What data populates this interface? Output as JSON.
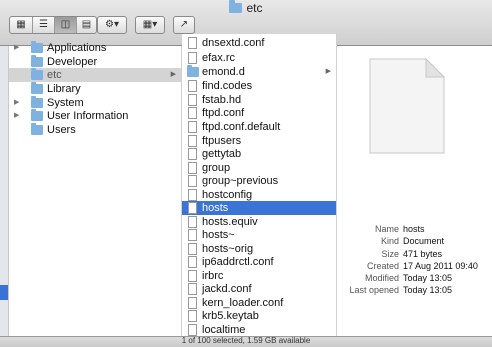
{
  "window": {
    "title": "etc"
  },
  "toolbar": {
    "view_icons": [
      "icon-view-icon",
      "list-view-icon",
      "column-view-icon",
      "coverflow-view-icon"
    ],
    "action_icon": "gear-icon",
    "arrange_icon": "arrange-grid-icon",
    "share_icon": "share-icon"
  },
  "column1": {
    "items": [
      {
        "label": "Applications",
        "icon": "folder-icon"
      },
      {
        "label": "Developer",
        "icon": "folder-icon"
      },
      {
        "label": "etc",
        "icon": "alias-folder-icon"
      },
      {
        "label": "Library",
        "icon": "folder-icon"
      },
      {
        "label": "System",
        "icon": "folder-icon"
      },
      {
        "label": "User Information",
        "icon": "alias-icon"
      },
      {
        "label": "Users",
        "icon": "folder-icon"
      }
    ]
  },
  "column2": {
    "items": [
      {
        "label": "dnsextd.conf"
      },
      {
        "label": "efax.rc"
      },
      {
        "label": "emond.d"
      },
      {
        "label": "find.codes"
      },
      {
        "label": "fstab.hd"
      },
      {
        "label": "ftpd.conf"
      },
      {
        "label": "ftpd.conf.default"
      },
      {
        "label": "ftpusers"
      },
      {
        "label": "gettytab"
      },
      {
        "label": "group"
      },
      {
        "label": "group~previous"
      },
      {
        "label": "hostconfig"
      },
      {
        "label": "hosts"
      },
      {
        "label": "hosts.equiv"
      },
      {
        "label": "hosts~"
      },
      {
        "label": "hosts~orig"
      },
      {
        "label": "ip6addrctl.conf"
      },
      {
        "label": "irbrc"
      },
      {
        "label": "jackd.conf"
      },
      {
        "label": "kern_loader.conf"
      },
      {
        "label": "krb5.keytab"
      },
      {
        "label": "localtime"
      }
    ]
  },
  "preview": {
    "icon": "generic-document-icon",
    "info": [
      {
        "label": "Name",
        "value": "hosts"
      },
      {
        "label": "Kind",
        "value": "Document"
      },
      {
        "label": "Size",
        "value": "471 bytes"
      },
      {
        "label": "Created",
        "value": "17 Aug 2011 09:40"
      },
      {
        "label": "Modified",
        "value": "Today 13:05"
      },
      {
        "label": "Last opened",
        "value": "Today 13:05"
      }
    ]
  },
  "status_bar": {
    "text": "1 of 100 selected, 1.59 GB available"
  },
  "colors": {
    "selection": "#3b74d7",
    "folder": "#7fb2e0"
  }
}
